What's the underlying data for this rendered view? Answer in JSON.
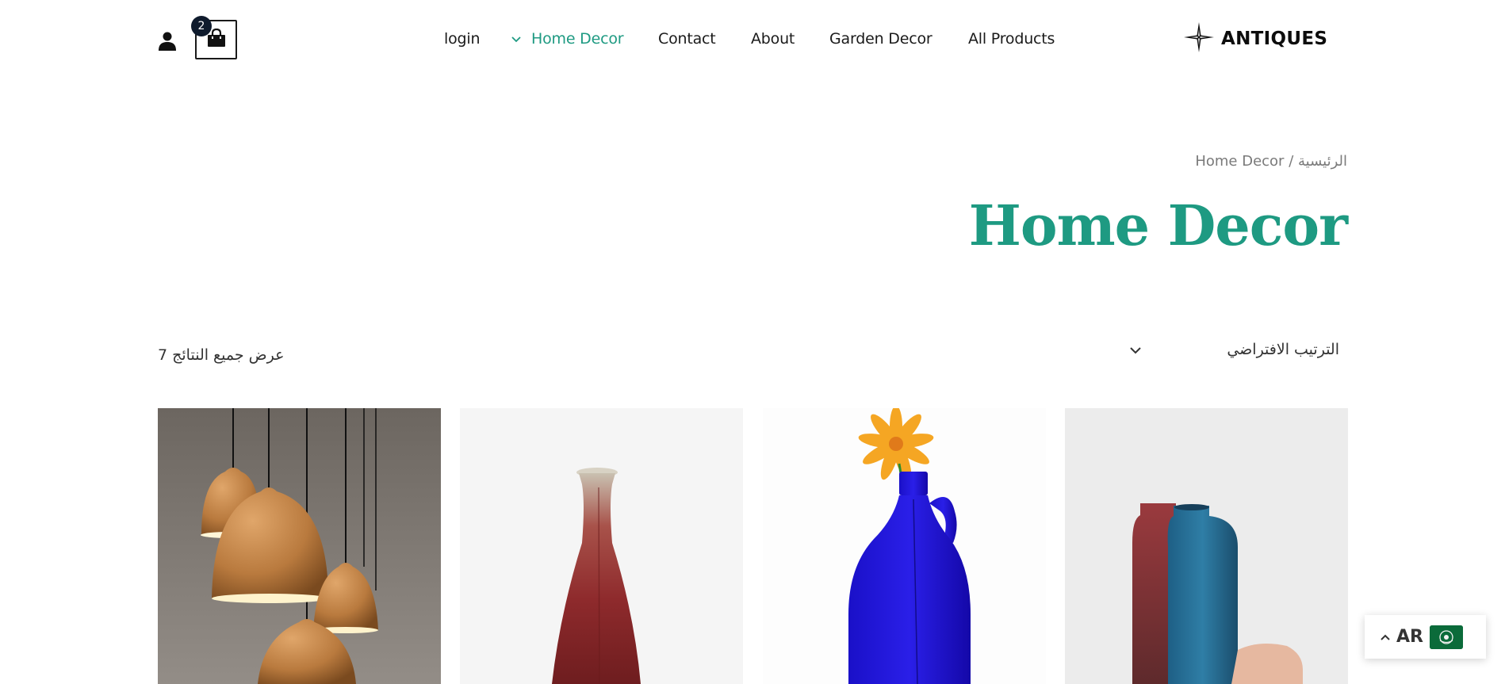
{
  "header": {
    "cart_count": "2",
    "nav": [
      {
        "label": "login",
        "active": false
      },
      {
        "label": "Home Decor",
        "active": true,
        "has_dropdown": true
      },
      {
        "label": "Contact",
        "active": false
      },
      {
        "label": "About",
        "active": false
      },
      {
        "label": "Garden Decor",
        "active": false
      },
      {
        "label": "All Products",
        "active": false
      }
    ],
    "logo_text": "ANTIQUES"
  },
  "breadcrumb": {
    "home": "الرئيسية",
    "separator": "/",
    "current": "Home Decor"
  },
  "page_title": "Home Decor",
  "toolbar": {
    "result_count": "عرض جميع النتائج 7",
    "sort_selected": "الترتيب الافتراضي"
  },
  "products": [
    {
      "image": "pendant-lamps-image"
    },
    {
      "image": "red-vase-image"
    },
    {
      "image": "blue-bottle-with-flower-image"
    },
    {
      "image": "red-and-blue-vases-image"
    }
  ],
  "language_switcher": {
    "code": "AR",
    "flag": "arab-league-flag-icon"
  },
  "colors": {
    "accent": "#1e9a82",
    "text": "#1a1a1a",
    "badge": "#0f1b2d"
  }
}
